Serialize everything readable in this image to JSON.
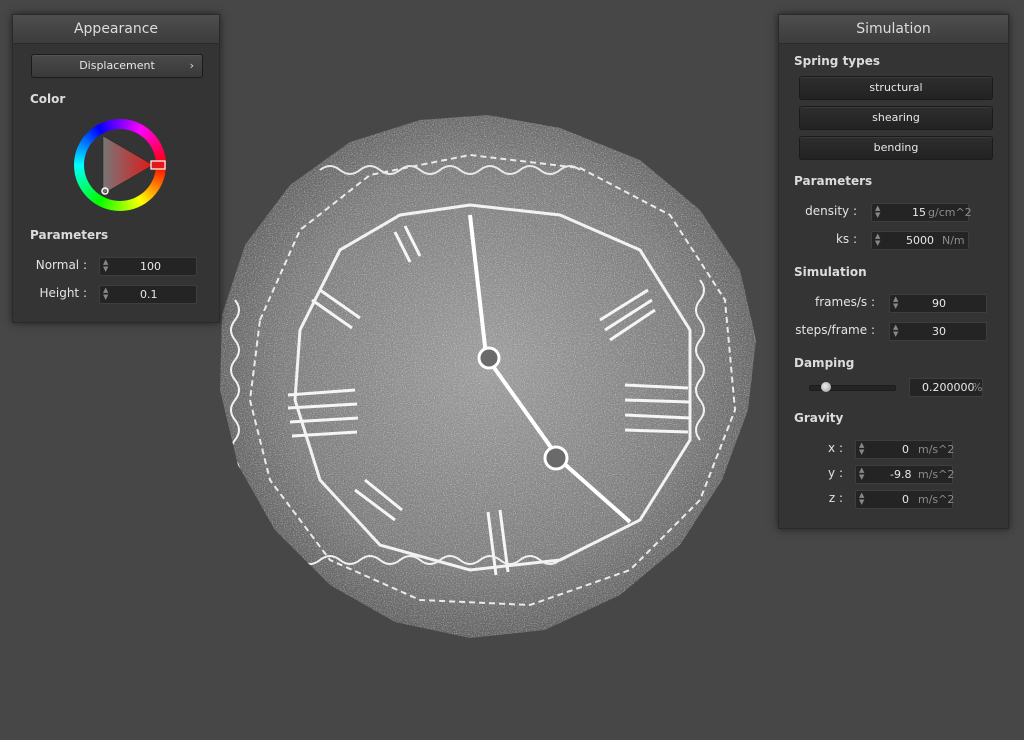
{
  "appearance": {
    "title": "Appearance",
    "shader_dropdown": "Displacement",
    "color_label": "Color",
    "parameters_label": "Parameters",
    "normal_label": "Normal :",
    "normal_value": "100",
    "height_label": "Height :",
    "height_value": "0.1"
  },
  "simulation": {
    "title": "Simulation",
    "spring_types_label": "Spring types",
    "spring_buttons": [
      "structural",
      "shearing",
      "bending"
    ],
    "parameters_label": "Parameters",
    "density_label": "density :",
    "density_value": "15",
    "density_unit": "g/cm^2",
    "ks_label": "ks :",
    "ks_value": "5000",
    "ks_unit": "N/m",
    "simulation_label": "Simulation",
    "fps_label": "frames/s :",
    "fps_value": "90",
    "steps_label": "steps/frame :",
    "steps_value": "30",
    "damping_label": "Damping",
    "damping_value": "0.200000",
    "damping_unit": "%",
    "damping_slider_fraction": 0.2,
    "gravity_label": "Gravity",
    "gx_label": "x :",
    "gx_value": "0",
    "gx_unit": "m/s^2",
    "gy_label": "y :",
    "gy_value": "-9.8",
    "gy_unit": "m/s^2",
    "gz_label": "z :",
    "gz_value": "0",
    "gz_unit": "m/s^2"
  },
  "colors": {
    "background": "#474747",
    "panel": "#343434",
    "picker_selected": "#e01818"
  },
  "icons": {
    "spinner": "spinner-arrows-icon",
    "dropdown": "chevron-right-icon"
  }
}
